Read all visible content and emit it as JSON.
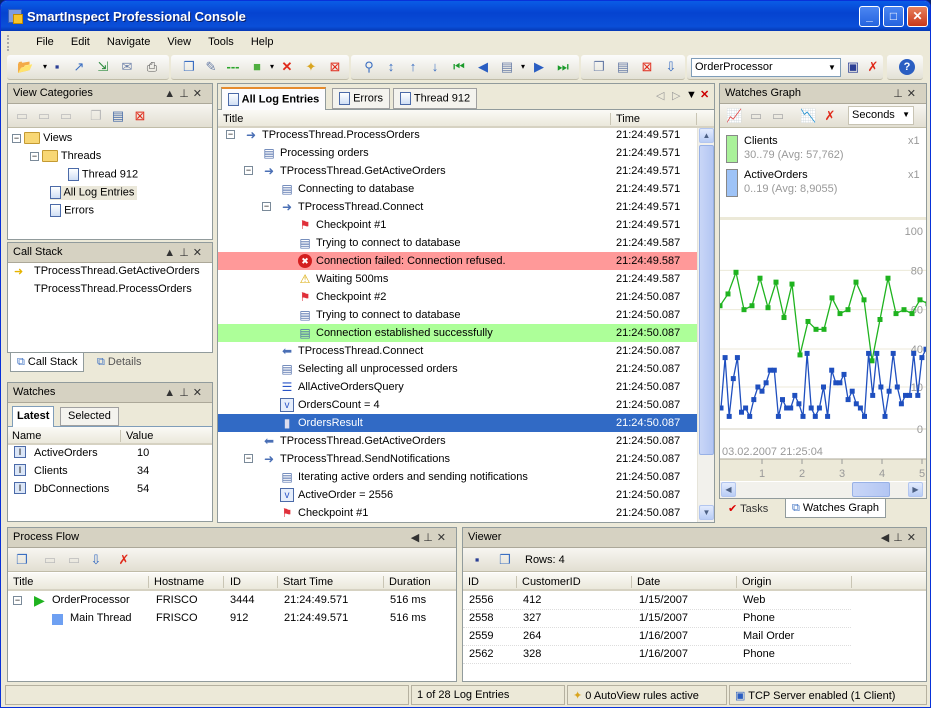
{
  "window": {
    "title": "SmartInspect Professional Console",
    "min_label": "_",
    "max_label": "□",
    "close_label": "✕"
  },
  "menu": [
    "File",
    "Edit",
    "Navigate",
    "View",
    "Tools",
    "Help"
  ],
  "toolbar": {
    "icons": [
      "open-icon",
      "save-icon",
      "export-icon",
      "import-icon",
      "email-icon",
      "print-icon",
      "copy-icon",
      "edit-icon",
      "separator-line-icon",
      "color-icon",
      "delete-icon",
      "new-view-icon",
      "clear-icon",
      "find-icon",
      "expand-icon",
      "jump-up-icon",
      "jump-down-icon",
      "first-icon",
      "prev-icon",
      "doc-menu-icon",
      "next-icon",
      "last-icon",
      "view-copy-icon",
      "view-list-icon",
      "view-delete-icon",
      "view-import-icon",
      "connection-save-icon",
      "connection-remove-icon",
      "help-icon"
    ],
    "session_combo": "OrderProcessor"
  },
  "view_categories": {
    "title": "View Categories",
    "tree": [
      {
        "label": "Views",
        "icon": "folder-icon"
      },
      {
        "label": "Threads",
        "icon": "folder-icon"
      },
      {
        "label": "Thread 912",
        "icon": "view-star-icon"
      },
      {
        "label": "All Log Entries",
        "icon": "view-icon"
      },
      {
        "label": "Errors",
        "icon": "view-icon"
      }
    ]
  },
  "call_stack": {
    "title": "Call Stack",
    "items": [
      "TProcessThread.GetActiveOrders",
      "TProcessThread.ProcessOrders"
    ],
    "tabs": [
      "Call Stack",
      "Details"
    ]
  },
  "watches": {
    "title": "Watches",
    "tabs": [
      "Latest",
      "Selected"
    ],
    "columns": [
      "Name",
      "Value"
    ],
    "rows": [
      {
        "name": "ActiveOrders",
        "value": "10"
      },
      {
        "name": "Clients",
        "value": "34"
      },
      {
        "name": "DbConnections",
        "value": "54"
      }
    ]
  },
  "log": {
    "tabs": [
      "All Log Entries",
      "Errors",
      "Thread 912"
    ],
    "columns": [
      "Title",
      "Time"
    ],
    "entries": [
      {
        "title": "TProcessThread.ProcessOrders",
        "time": "21:24:49.571",
        "icon": "enter-method-icon",
        "level": 0,
        "expand": true
      },
      {
        "title": "Processing orders",
        "time": "21:24:49.571",
        "icon": "message-icon",
        "level": 1
      },
      {
        "title": "TProcessThread.GetActiveOrders",
        "time": "21:24:49.571",
        "icon": "enter-method-icon",
        "level": 1,
        "expand": true
      },
      {
        "title": "Connecting to database",
        "time": "21:24:49.571",
        "icon": "message-icon",
        "level": 2
      },
      {
        "title": "TProcessThread.Connect",
        "time": "21:24:49.571",
        "icon": "enter-method-icon",
        "level": 2,
        "expand": true
      },
      {
        "title": "Checkpoint #1",
        "time": "21:24:49.571",
        "icon": "checkpoint-icon",
        "level": 3
      },
      {
        "title": "Trying to connect to database",
        "time": "21:24:49.587",
        "icon": "message-icon",
        "level": 3
      },
      {
        "title": "Connection failed: Connection refused.",
        "time": "21:24:49.587",
        "icon": "error-icon",
        "level": 3,
        "bg": "#ff9999"
      },
      {
        "title": "Waiting 500ms",
        "time": "21:24:49.587",
        "icon": "warning-icon",
        "level": 3
      },
      {
        "title": "Checkpoint #2",
        "time": "21:24:50.087",
        "icon": "checkpoint-icon",
        "level": 3
      },
      {
        "title": "Trying to connect to database",
        "time": "21:24:50.087",
        "icon": "message-icon",
        "level": 3
      },
      {
        "title": "Connection established successfully",
        "time": "21:24:50.087",
        "icon": "message-icon",
        "level": 3,
        "bg": "#adff99"
      },
      {
        "title": "TProcessThread.Connect",
        "time": "21:24:50.087",
        "icon": "leave-method-icon",
        "level": 2
      },
      {
        "title": "Selecting all unprocessed orders",
        "time": "21:24:50.087",
        "icon": "message-icon",
        "level": 2
      },
      {
        "title": "AllActiveOrdersQuery",
        "time": "21:24:50.087",
        "icon": "sql-icon",
        "level": 2
      },
      {
        "title": "OrdersCount = 4",
        "time": "21:24:50.087",
        "icon": "variable-icon",
        "level": 2
      },
      {
        "title": "OrdersResult",
        "time": "21:24:50.087",
        "icon": "database-icon",
        "level": 2,
        "selected": true
      },
      {
        "title": "TProcessThread.GetActiveOrders",
        "time": "21:24:50.087",
        "icon": "leave-method-icon",
        "level": 1
      },
      {
        "title": "TProcessThread.SendNotifications",
        "time": "21:24:50.087",
        "icon": "enter-method-icon",
        "level": 1,
        "expand": true
      },
      {
        "title": "Iterating active orders and sending notifications",
        "time": "21:24:50.087",
        "icon": "message-icon",
        "level": 2
      },
      {
        "title": "ActiveOrder = 2556",
        "time": "21:24:50.087",
        "icon": "variable-icon",
        "level": 2
      },
      {
        "title": "Checkpoint #1",
        "time": "21:24:50.087",
        "icon": "checkpoint-icon",
        "level": 2
      }
    ]
  },
  "watches_graph": {
    "title": "Watches Graph",
    "unit": "Seconds",
    "legend": [
      {
        "name": "Clients",
        "range": "30..79 (Avg: 57,762)",
        "scale": "x1",
        "color": "#aaf19a"
      },
      {
        "name": "ActiveOrders",
        "range": "0..19 (Avg: 8,9055)",
        "scale": "x1",
        "color": "#9ec3f7"
      }
    ],
    "timestamp": "03.02.2007 21:25:04",
    "tabs": [
      "Tasks",
      "Watches Graph"
    ]
  },
  "chart_data": {
    "type": "line",
    "title": "Watches Graph",
    "xlabel": "Seconds",
    "x_ticks": [
      "1",
      "2",
      "3",
      "4",
      "5"
    ],
    "upper_axis": {
      "ticks": [
        "100",
        "80",
        "60",
        "40"
      ],
      "ylim": [
        30,
        100
      ]
    },
    "lower_axis": {
      "ticks": [
        "0",
        "10"
      ],
      "ylim": [
        0,
        20
      ]
    },
    "series": [
      {
        "name": "Clients",
        "color": "#1fb31f",
        "values": [
          62,
          68,
          79,
          60,
          62,
          76,
          61,
          74,
          56,
          73,
          37,
          54,
          50,
          50,
          66,
          58,
          60,
          74,
          65,
          34,
          55,
          76,
          58,
          60,
          58,
          65,
          63
        ]
      },
      {
        "name": "ActiveOrders",
        "color": "#1f4fbf",
        "values": [
          5,
          17,
          3,
          12,
          17,
          4,
          5,
          3,
          7,
          10,
          9,
          11,
          14,
          14,
          3,
          7,
          5,
          5,
          8,
          6,
          3,
          18,
          5,
          3,
          5,
          10,
          3,
          14,
          11,
          11,
          13,
          7,
          9,
          6,
          5,
          3,
          18,
          8,
          18,
          10,
          3,
          9,
          18,
          10,
          6,
          8,
          8,
          18,
          8,
          17,
          19
        ]
      }
    ]
  },
  "process_flow": {
    "title": "Process Flow",
    "columns": [
      "Title",
      "Hostname",
      "ID",
      "Start Time",
      "Duration"
    ],
    "rows": [
      {
        "title": "OrderProcessor",
        "hostname": "FRISCO",
        "id": "3444",
        "start": "21:24:49.571",
        "duration": "516 ms"
      },
      {
        "title": "Main Thread",
        "hostname": "FRISCO",
        "id": "912",
        "start": "21:24:49.571",
        "duration": "516 ms"
      }
    ]
  },
  "viewer": {
    "title": "Viewer",
    "rows_label": "Rows: 4",
    "columns": [
      "ID",
      "CustomerID",
      "Date",
      "Origin"
    ],
    "rows": [
      [
        "2556",
        "412",
        "1/15/2007",
        "Web"
      ],
      [
        "2558",
        "327",
        "1/15/2007",
        "Phone"
      ],
      [
        "2559",
        "264",
        "1/16/2007",
        "Mail Order"
      ],
      [
        "2562",
        "328",
        "1/16/2007",
        "Phone"
      ]
    ]
  },
  "status": {
    "entries": "1 of 28 Log Entries",
    "autoview": "0 AutoView rules active",
    "tcp": "TCP Server enabled (1 Client)"
  }
}
